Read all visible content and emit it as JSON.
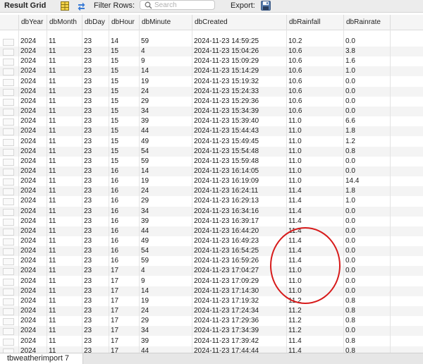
{
  "toolbar": {
    "title": "Result Grid",
    "filter_label": "Filter Rows:",
    "search_placeholder": "Search",
    "export_label": "Export:"
  },
  "columns": [
    "dbYear",
    "dbMonth",
    "dbDay",
    "dbHour",
    "dbMinute",
    "dbCreated",
    "dbRainfall",
    "dbRainrate"
  ],
  "rows": [
    [
      "2024",
      "11",
      "23",
      "14",
      "59",
      "2024-11-23 14:59:25",
      "10.2",
      "0.0"
    ],
    [
      "2024",
      "11",
      "23",
      "15",
      "4",
      "2024-11-23 15:04:26",
      "10.6",
      "3.8"
    ],
    [
      "2024",
      "11",
      "23",
      "15",
      "9",
      "2024-11-23 15:09:29",
      "10.6",
      "1.6"
    ],
    [
      "2024",
      "11",
      "23",
      "15",
      "14",
      "2024-11-23 15:14:29",
      "10.6",
      "1.0"
    ],
    [
      "2024",
      "11",
      "23",
      "15",
      "19",
      "2024-11-23 15:19:32",
      "10.6",
      "0.0"
    ],
    [
      "2024",
      "11",
      "23",
      "15",
      "24",
      "2024-11-23 15:24:33",
      "10.6",
      "0.0"
    ],
    [
      "2024",
      "11",
      "23",
      "15",
      "29",
      "2024-11-23 15:29:36",
      "10.6",
      "0.0"
    ],
    [
      "2024",
      "11",
      "23",
      "15",
      "34",
      "2024-11-23 15:34:39",
      "10.6",
      "0.0"
    ],
    [
      "2024",
      "11",
      "23",
      "15",
      "39",
      "2024-11-23 15:39:40",
      "11.0",
      "6.6"
    ],
    [
      "2024",
      "11",
      "23",
      "15",
      "44",
      "2024-11-23 15:44:43",
      "11.0",
      "1.8"
    ],
    [
      "2024",
      "11",
      "23",
      "15",
      "49",
      "2024-11-23 15:49:45",
      "11.0",
      "1.2"
    ],
    [
      "2024",
      "11",
      "23",
      "15",
      "54",
      "2024-11-23 15:54:48",
      "11.0",
      "0.8"
    ],
    [
      "2024",
      "11",
      "23",
      "15",
      "59",
      "2024-11-23 15:59:48",
      "11.0",
      "0.0"
    ],
    [
      "2024",
      "11",
      "23",
      "16",
      "14",
      "2024-11-23 16:14:05",
      "11.0",
      "0.0"
    ],
    [
      "2024",
      "11",
      "23",
      "16",
      "19",
      "2024-11-23 16:19:09",
      "11.0",
      "14.4"
    ],
    [
      "2024",
      "11",
      "23",
      "16",
      "24",
      "2024-11-23 16:24:11",
      "11.4",
      "1.8"
    ],
    [
      "2024",
      "11",
      "23",
      "16",
      "29",
      "2024-11-23 16:29:13",
      "11.4",
      "1.0"
    ],
    [
      "2024",
      "11",
      "23",
      "16",
      "34",
      "2024-11-23 16:34:16",
      "11.4",
      "0.0"
    ],
    [
      "2024",
      "11",
      "23",
      "16",
      "39",
      "2024-11-23 16:39:17",
      "11.4",
      "0.0"
    ],
    [
      "2024",
      "11",
      "23",
      "16",
      "44",
      "2024-11-23 16:44:20",
      "11.4",
      "0.0"
    ],
    [
      "2024",
      "11",
      "23",
      "16",
      "49",
      "2024-11-23 16:49:23",
      "11.4",
      "0.0"
    ],
    [
      "2024",
      "11",
      "23",
      "16",
      "54",
      "2024-11-23 16:54:25",
      "11.4",
      "0.0"
    ],
    [
      "2024",
      "11",
      "23",
      "16",
      "59",
      "2024-11-23 16:59:26",
      "11.4",
      "0.0"
    ],
    [
      "2024",
      "11",
      "23",
      "17",
      "4",
      "2024-11-23 17:04:27",
      "11.0",
      "0.0"
    ],
    [
      "2024",
      "11",
      "23",
      "17",
      "9",
      "2024-11-23 17:09:29",
      "11.0",
      "0.0"
    ],
    [
      "2024",
      "11",
      "23",
      "17",
      "14",
      "2024-11-23 17:14:30",
      "11.0",
      "0.0"
    ],
    [
      "2024",
      "11",
      "23",
      "17",
      "19",
      "2024-11-23 17:19:32",
      "11.2",
      "0.8"
    ],
    [
      "2024",
      "11",
      "23",
      "17",
      "24",
      "2024-11-23 17:24:34",
      "11.2",
      "0.8"
    ],
    [
      "2024",
      "11",
      "23",
      "17",
      "29",
      "2024-11-23 17:29:36",
      "11.2",
      "0.8"
    ],
    [
      "2024",
      "11",
      "23",
      "17",
      "34",
      "2024-11-23 17:34:39",
      "11.2",
      "0.0"
    ],
    [
      "2024",
      "11",
      "23",
      "17",
      "39",
      "2024-11-23 17:39:42",
      "11.4",
      "0.8"
    ],
    [
      "2024",
      "11",
      "23",
      "17",
      "44",
      "2024-11-23 17:44:44",
      "11.4",
      "0.8"
    ]
  ],
  "bottom_tab": "tbweatherimport 7",
  "icons": {
    "grid": "grid-icon",
    "refresh": "refresh-icon",
    "filter": "filter-icon",
    "search": "search-icon",
    "export": "export-icon"
  },
  "colors": {
    "annotation": "#d71b1b"
  }
}
